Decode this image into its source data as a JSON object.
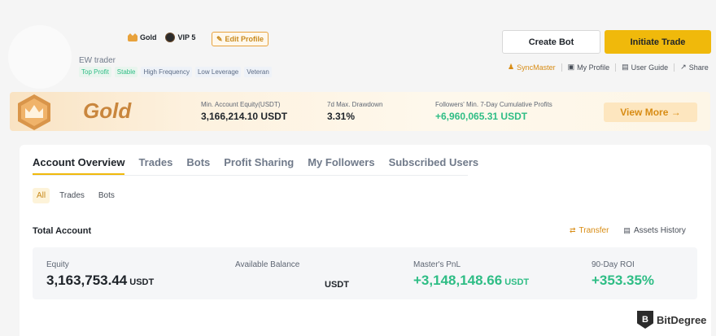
{
  "profile": {
    "badge_gold": "Gold",
    "badge_vip": "VIP 5",
    "edit_profile": "Edit Profile",
    "username": "EW trader",
    "tags": [
      {
        "label": "Top Profit",
        "tone": "green"
      },
      {
        "label": "Stable",
        "tone": "green"
      },
      {
        "label": "High Frequency",
        "tone": "blue"
      },
      {
        "label": "Low Leverage",
        "tone": "blue"
      },
      {
        "label": "Veteran",
        "tone": "blue"
      }
    ]
  },
  "header_actions": {
    "create_bot": "Create Bot",
    "initiate_trade": "Initiate Trade",
    "links": {
      "sync_master": "SyncMaster",
      "my_profile": "My Profile",
      "user_guide": "User Guide",
      "share": "Share"
    }
  },
  "banner": {
    "title": "Gold",
    "min_equity_label": "Min. Account Equity(USDT)",
    "min_equity_value": "3,166,214.10 USDT",
    "drawdown_label": "7d Max. Drawdown",
    "drawdown_value": "3.31%",
    "profits_label": "Followers' Min. 7-Day Cumulative Profits",
    "profits_value": "+6,960,065.31 USDT",
    "view_more": "View More →"
  },
  "tabs": [
    "Account Overview",
    "Trades",
    "Bots",
    "Profit Sharing",
    "My Followers",
    "Subscribed Users"
  ],
  "filters": [
    "All",
    "Trades",
    "Bots"
  ],
  "total_account": {
    "title": "Total Account",
    "transfer": "Transfer",
    "assets_history": "Assets History",
    "equity_label": "Equity",
    "equity_value": "3,163,753.44",
    "equity_unit": "USDT",
    "available_label": "Available Balance",
    "available_unit": "USDT",
    "pnl_label": "Master's PnL",
    "pnl_value": "+3,148,148.66",
    "pnl_unit": "USDT",
    "roi_label": "90-Day ROI",
    "roi_value": "+353.35%"
  },
  "watermark": "BitDegree",
  "colors": {
    "accent": "#f0b90b",
    "gold_text": "#c9863d",
    "positive": "#2ebd85"
  }
}
